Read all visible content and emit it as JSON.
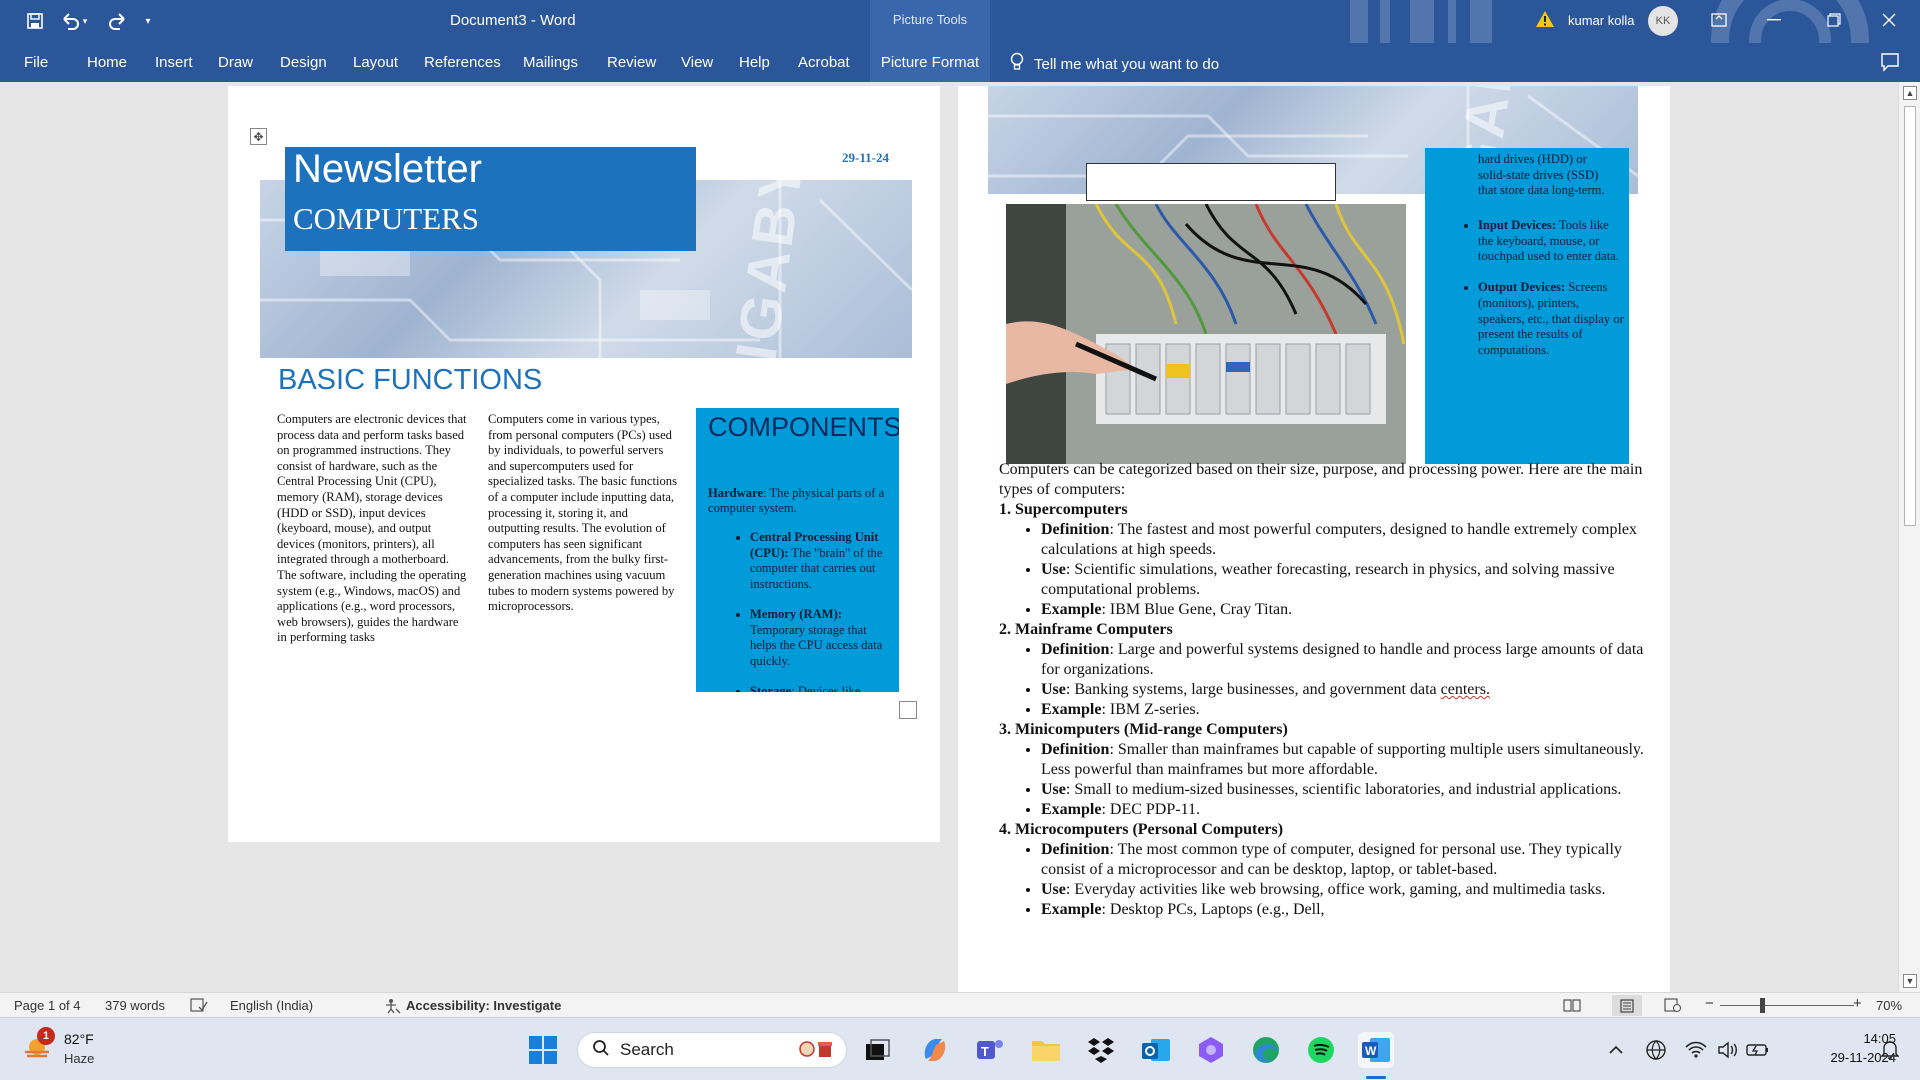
{
  "titlebar": {
    "doc_title": "Document3  -  Word",
    "context_group": "Picture Tools",
    "user_name": "kumar kolla",
    "user_initials": "KK"
  },
  "ribbon": {
    "tabs": [
      "File",
      "Home",
      "Insert",
      "Draw",
      "Design",
      "Layout",
      "References",
      "Mailings",
      "Review",
      "View",
      "Help",
      "Acrobat",
      "Picture Format"
    ],
    "active_tab": "Picture Format",
    "tell_me": "Tell me what you want to do"
  },
  "page1": {
    "newsletter_title": "Newsletter",
    "newsletter_subtitle": "COMPUTERS",
    "date": "29-11-24",
    "section_heading": "BASIC FUNCTIONS",
    "col1": "Computers are electronic devices that process data and perform tasks based on programmed instructions. They consist of hardware, such as the Central Processing Unit (CPU), memory (RAM), storage devices (HDD or SSD), input devices (keyboard, mouse), and output devices (monitors, printers), all integrated through a motherboard. The software, including the operating system (e.g., Windows, macOS) and applications (e.g., word processors, web browsers), guides the hardware in performing tasks",
    "col2": "Computers come in various types, from personal computers (PCs) used by individuals, to powerful servers and supercomputers used for specialized tasks. The basic functions of a computer include inputting data, processing it, storing it, and outputting results. The evolution of computers has seen significant advancements, from the bulky first-generation machines using vacuum tubes to modern systems powered by microprocessors.",
    "components": {
      "heading": "COMPONENTS",
      "hardware_label": "Hardware",
      "hardware_text": ": The physical parts of a computer system.",
      "items": [
        {
          "label": "Central Processing Unit (CPU):",
          "text": " The \"brain\" of the computer that carries out instructions."
        },
        {
          "label": "Memory (RAM):",
          "text": " Temporary storage that helps the CPU access data quickly."
        },
        {
          "label": "Storage",
          "text": ": Devices like"
        }
      ]
    }
  },
  "page2": {
    "side_fragment": "hard drives (HDD) or solid-state drives (SSD) that store data long-term.",
    "side_items": [
      {
        "label": "Input Devices:",
        "text": " Tools like the keyboard, mouse, or touchpad used to enter data."
      },
      {
        "label": "Output Devices:",
        "text": " Screens (monitors), printers, speakers, etc., that display or present the results of computations."
      }
    ],
    "intro": "Computers can be categorized based on their size, purpose, and processing power. Here are the main types of computers:",
    "sections": [
      {
        "title": "1. Supercomputers",
        "items": [
          {
            "label": "Definition",
            "text": ": The fastest and most powerful computers, designed to handle extremely complex calculations at high speeds."
          },
          {
            "label": "Use",
            "text": ": Scientific simulations, weather forecasting, research in physics, and solving massive computational problems."
          },
          {
            "label": "Example",
            "text": ": IBM Blue Gene, Cray Titan."
          }
        ]
      },
      {
        "title": "2. Mainframe Computers",
        "items": [
          {
            "label": "Definition",
            "text": ": Large and powerful systems designed to handle and process large amounts of data for organizations."
          },
          {
            "label": "Use",
            "text": ": Banking systems, large businesses, and government data ",
            "flagged": "centers."
          },
          {
            "label": "Example",
            "text": ": IBM Z-series."
          }
        ]
      },
      {
        "title": "3. Minicomputers (Mid-range Computers)",
        "items": [
          {
            "label": "Definition",
            "text": ": Smaller than mainframes but capable of supporting multiple users simultaneously. Less powerful than mainframes but more affordable."
          },
          {
            "label": "Use",
            "text": ": Small to medium-sized businesses, scientific laboratories, and industrial applications."
          },
          {
            "label": "Example",
            "text": ": DEC PDP-11."
          }
        ]
      },
      {
        "title": "4. Microcomputers (Personal Computers)",
        "items": [
          {
            "label": "Definition",
            "text": ": The most common type of computer, designed for personal use. They typically consist of a microprocessor and can be desktop, laptop, or tablet-based."
          },
          {
            "label": "Use",
            "text": ": Everyday activities like web browsing, office work, gaming, and multimedia tasks."
          },
          {
            "label": "Example",
            "text": ": Desktop PCs, Laptops (e.g., Dell,"
          }
        ]
      }
    ]
  },
  "statusbar": {
    "page": "Page 1 of 4",
    "words": "379 words",
    "language": "English (India)",
    "accessibility": "Accessibility: Investigate",
    "zoom": "70%"
  },
  "taskbar": {
    "weather_temp": "82°F",
    "weather_desc": "Haze",
    "weather_badge": "1",
    "search_label": "Search",
    "time": "14:05",
    "date": "29-11-2024"
  },
  "colors": {
    "word_blue": "#2b579a",
    "heading_blue": "#1e72bd",
    "components_cyan": "#019bd9"
  }
}
